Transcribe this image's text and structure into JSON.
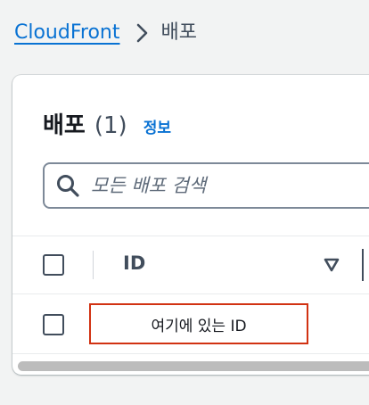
{
  "breadcrumb": {
    "root": "CloudFront",
    "current": "배포"
  },
  "panel": {
    "title": "배포",
    "count": "(1)",
    "info_link": "정보"
  },
  "search": {
    "placeholder": "모든 배포 검색"
  },
  "table": {
    "columns": [
      "ID"
    ],
    "rows": [
      {
        "id": "여기에 있는 ID"
      }
    ]
  },
  "colors": {
    "link": "#0972d3",
    "highlight_border": "#d13212",
    "background": "#f2f3f3"
  }
}
